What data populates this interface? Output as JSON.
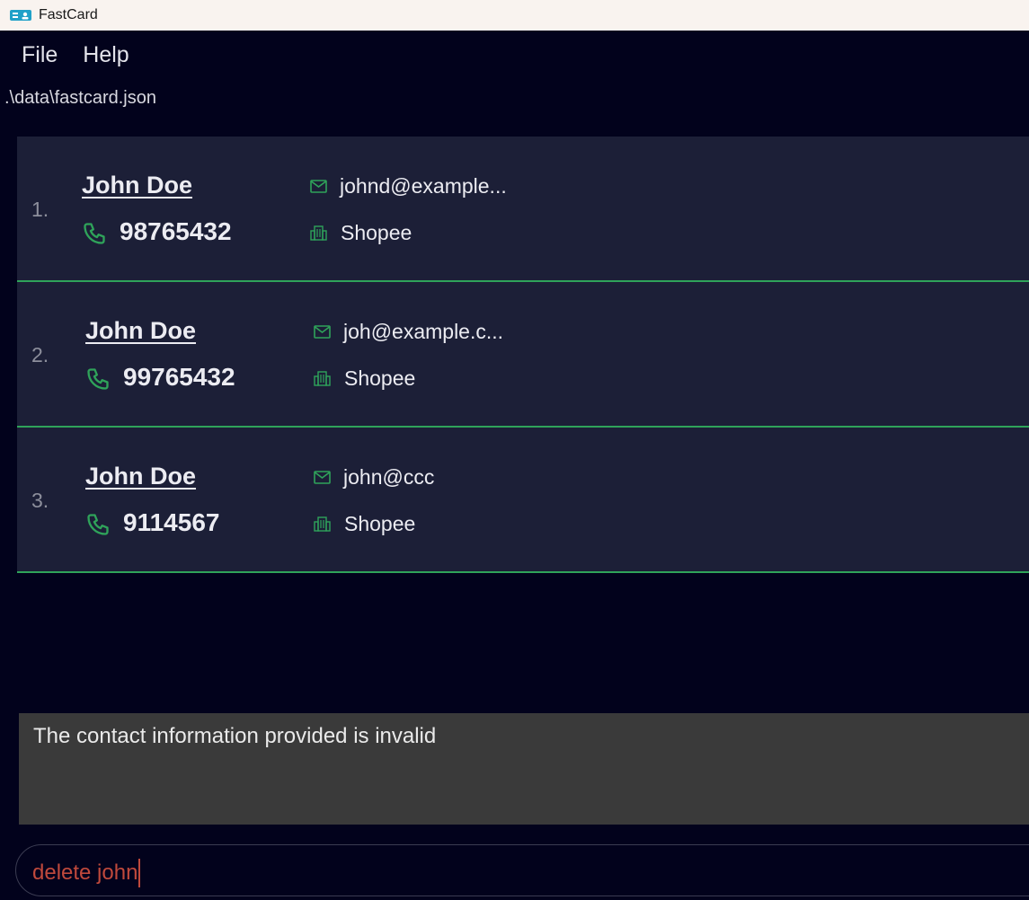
{
  "window": {
    "title": "FastCard"
  },
  "menu": {
    "file": "File",
    "help": "Help"
  },
  "status": {
    "file_path": ".\\data\\fastcard.json"
  },
  "contacts": [
    {
      "index": "1.",
      "name": "John Doe",
      "phone": "98765432",
      "email": "johnd@example...",
      "company": "Shopee"
    },
    {
      "index": "2.",
      "name": "John Doe",
      "phone": "99765432",
      "email": "joh@example.c...",
      "company": "Shopee"
    },
    {
      "index": "3.",
      "name": "John Doe",
      "phone": "9114567",
      "email": "john@ccc",
      "company": "Shopee"
    }
  ],
  "result": {
    "message": "The contact information provided is invalid"
  },
  "command": {
    "value": "delete john"
  },
  "icons": {
    "phone": "phone-icon",
    "email": "mail-icon",
    "company": "building-icon",
    "app": "card-icon"
  },
  "colors": {
    "accent": "#2fa35a",
    "card_bg": "#1c1f37",
    "app_bg": "#02021c",
    "command_text": "#c0493c"
  }
}
